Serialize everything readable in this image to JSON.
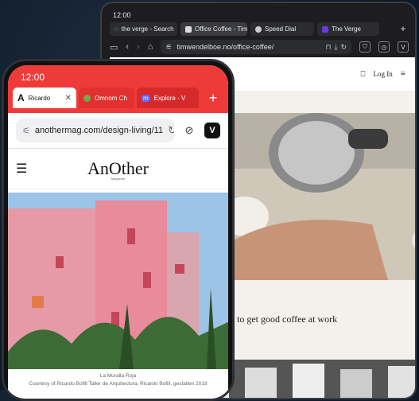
{
  "tablet": {
    "time": "12:00",
    "tabs": [
      {
        "label": "the verge - Search",
        "icon": "loading-icon"
      },
      {
        "label": "Office Coffee - Tim",
        "icon": "page-icon",
        "active": true
      },
      {
        "label": "Speed Dial",
        "icon": "speed-dial-icon"
      },
      {
        "label": "The Verge",
        "icon": "verge-icon"
      }
    ],
    "url": "timwendelboe.no/office-coffee/",
    "login": "Log In",
    "headline": "to get good coffee at work"
  },
  "phone": {
    "time": "12:00",
    "tabs": [
      {
        "label": "Ricardo",
        "letter": "A"
      },
      {
        "label": "Omnom Ch"
      },
      {
        "label": "Explore - V",
        "letter": "m"
      }
    ],
    "url": "anothermag.com/design-living/11",
    "logo": "AnOther",
    "logo_sub": "Magazine",
    "caption_title": "La Muralla Roja",
    "caption_credit": "Courtesy of Ricardo Bofill Taller de Arquitectura, Ricardo Bofill, gestalten 2019"
  },
  "colors": {
    "phone_accent": "#ef3a3a",
    "background": "#0f1a28"
  }
}
